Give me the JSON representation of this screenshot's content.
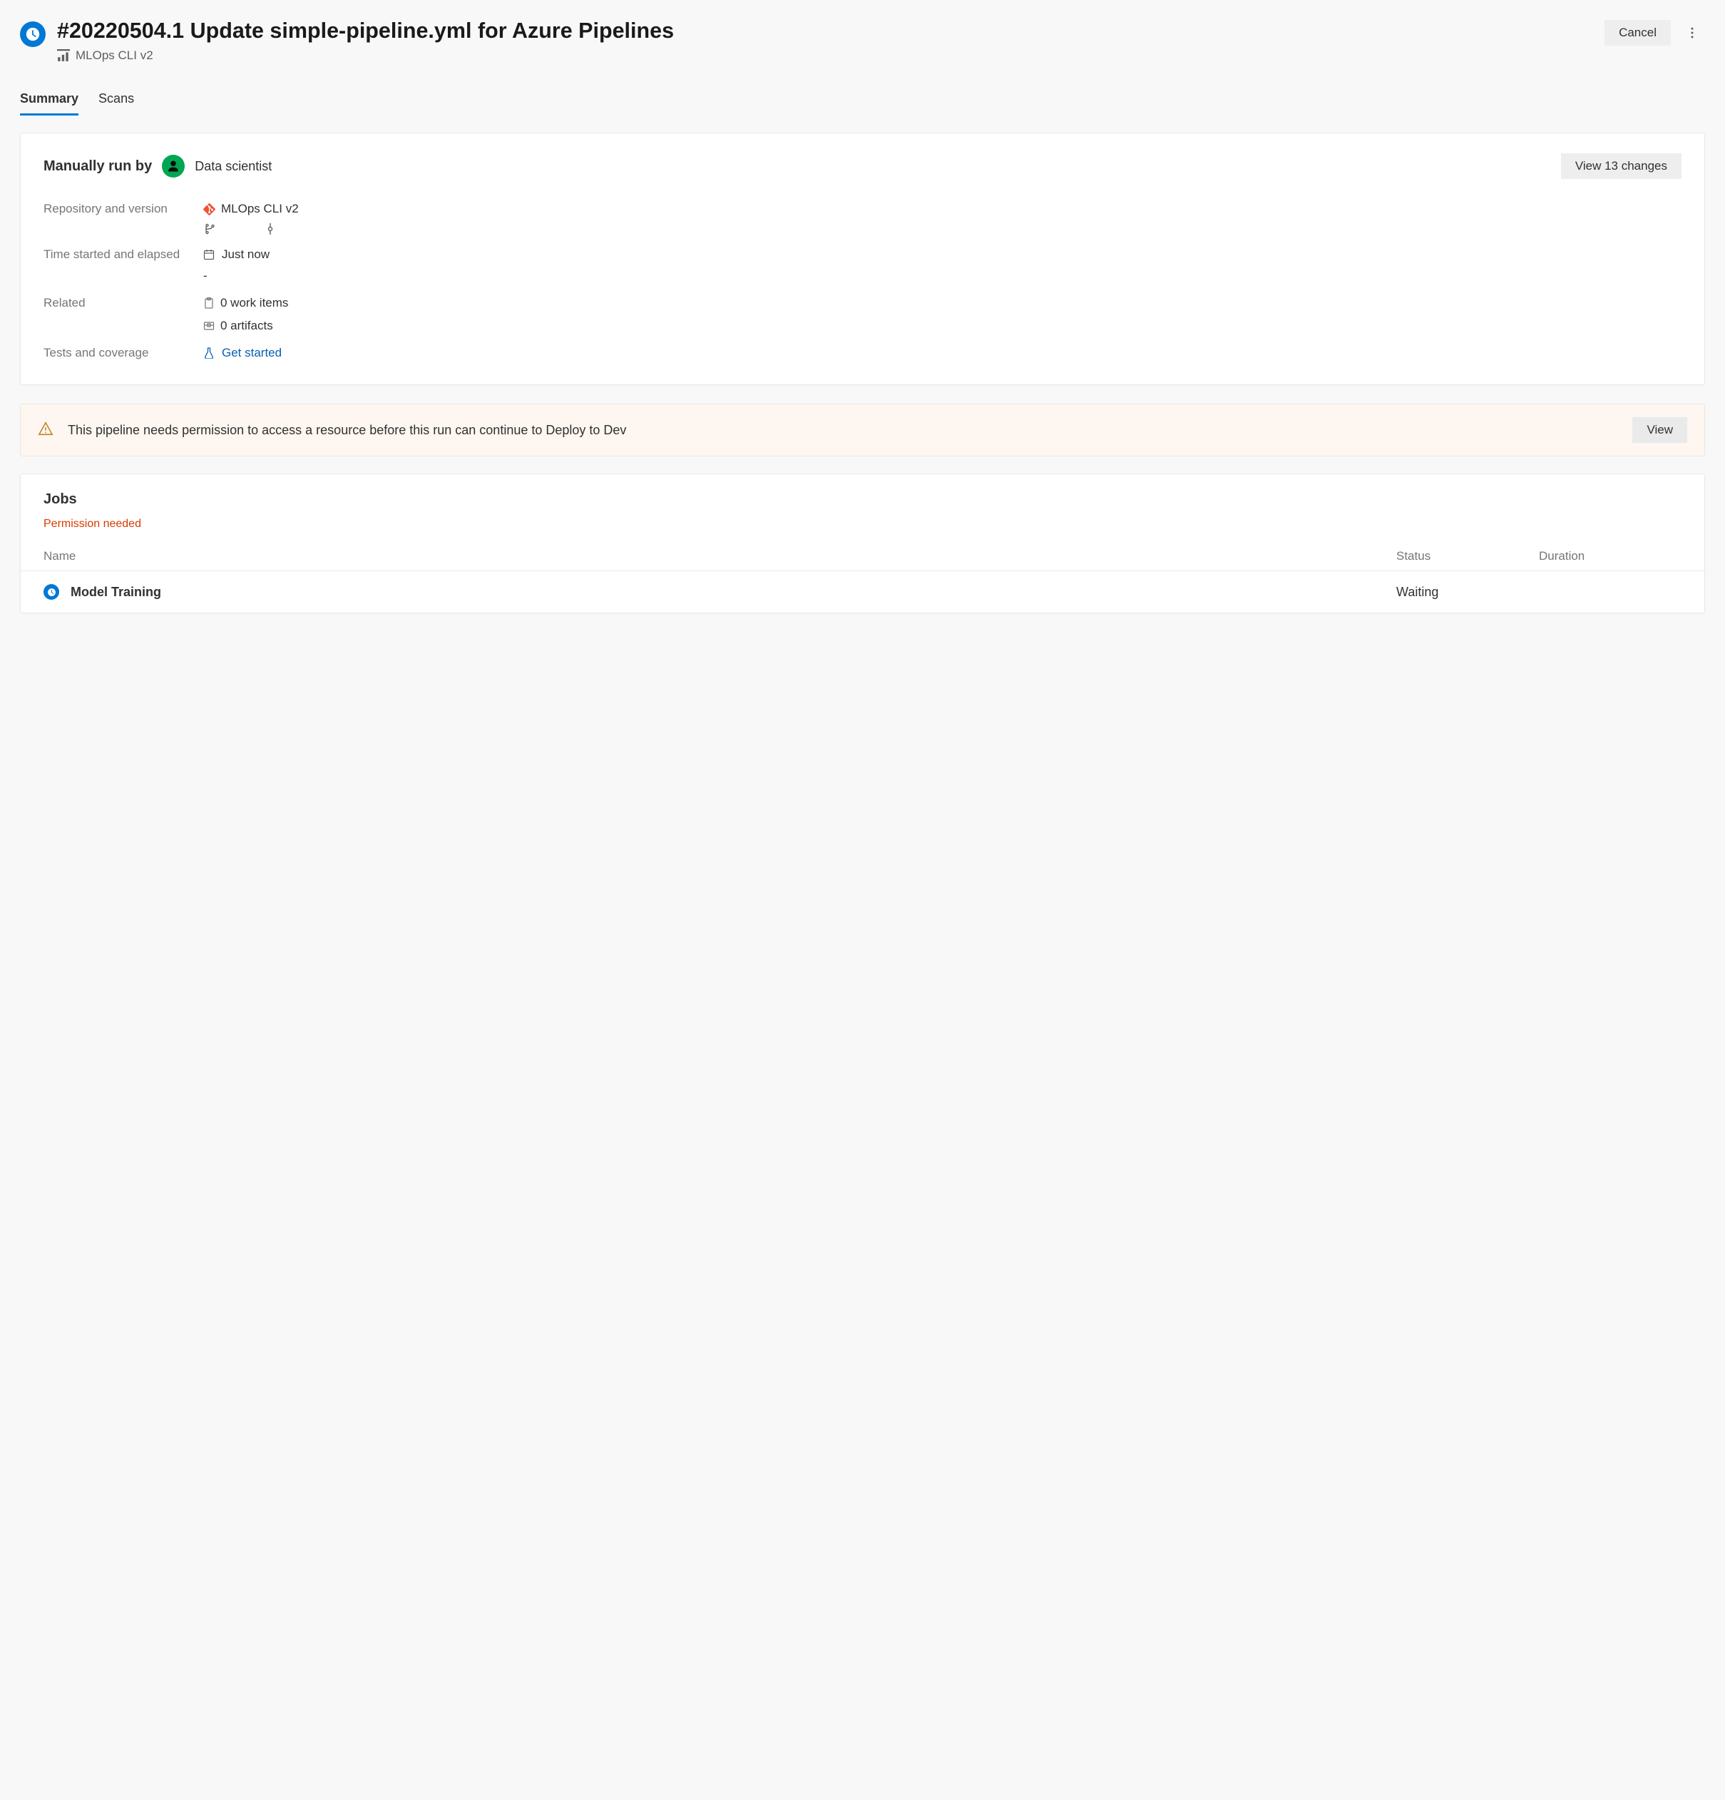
{
  "header": {
    "title": "#20220504.1 Update simple-pipeline.yml for Azure Pipelines",
    "pipeline_name": "MLOps CLI v2",
    "cancel_label": "Cancel"
  },
  "tabs": [
    {
      "label": "Summary",
      "active": true
    },
    {
      "label": "Scans",
      "active": false
    }
  ],
  "summary": {
    "run_by_label": "Manually run by",
    "run_by_user": "Data scientist",
    "view_changes_label": "View 13 changes",
    "facts": {
      "repo_label": "Repository and version",
      "repo_name": "MLOps CLI v2",
      "time_label": "Time started and elapsed",
      "time_started": "Just now",
      "elapsed": "-",
      "related_label": "Related",
      "work_items": "0 work items",
      "artifacts": "0 artifacts",
      "tests_label": "Tests and coverage",
      "tests_link": "Get started"
    }
  },
  "alert": {
    "message": "This pipeline needs permission to access a resource before this run can continue to Deploy to Dev",
    "view_label": "View"
  },
  "jobs": {
    "title": "Jobs",
    "permission_needed": "Permission needed",
    "columns": {
      "name": "Name",
      "status": "Status",
      "duration": "Duration"
    },
    "rows": [
      {
        "name": "Model Training",
        "status": "Waiting",
        "duration": ""
      }
    ]
  }
}
